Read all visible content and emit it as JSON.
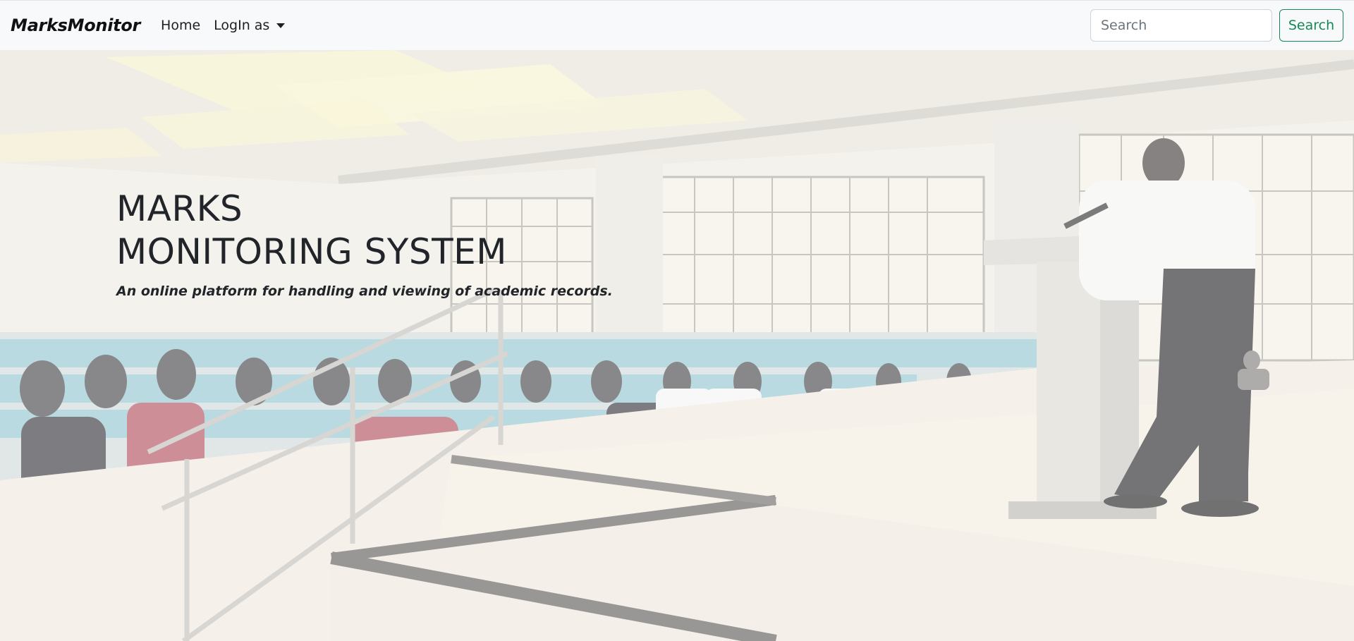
{
  "navbar": {
    "brand": "MarksMonitor",
    "home_label": "Home",
    "login_label": "LogIn as",
    "search_placeholder": "Search",
    "search_button_label": "Search",
    "accent_color": "#198754"
  },
  "hero": {
    "title_line1": "MARKS",
    "title_line2": "MONITORING SYSTEM",
    "subtitle": "An online platform for handling and viewing of academic records."
  }
}
